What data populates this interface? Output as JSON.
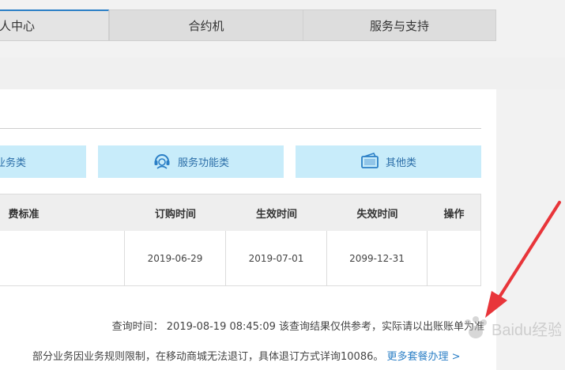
{
  "nav": {
    "tabs": [
      {
        "label": "人中心",
        "active": true
      },
      {
        "label": "合约机",
        "active": false
      },
      {
        "label": "服务与支持",
        "active": false
      }
    ]
  },
  "categories": [
    {
      "label": "业务类",
      "icon": "none"
    },
    {
      "label": "服务功能类",
      "icon": "headset-icon"
    },
    {
      "label": "其他类",
      "icon": "card-icon"
    }
  ],
  "table": {
    "headers": [
      "费标准",
      "订购时间",
      "生效时间",
      "失效时间",
      "操作"
    ],
    "rows": [
      [
        "",
        "2019-06-29",
        "2019-07-01",
        "2099-12-31",
        ""
      ]
    ]
  },
  "notes": {
    "query_time": "查询时间：  2019-08-19 08:45:09 该查询结果仅供参考，实际请以出账账单为准",
    "rule": "部分业务因业务规则限制，在移动商城无法退订，具体退订方式详询10086。",
    "more_link": "更多套餐办理 >"
  },
  "watermark": {
    "text": "Baidu经验"
  },
  "colors": {
    "accent": "#2b7fc6",
    "category_bg": "#c8ecfa",
    "arrow": "#e8353a"
  }
}
